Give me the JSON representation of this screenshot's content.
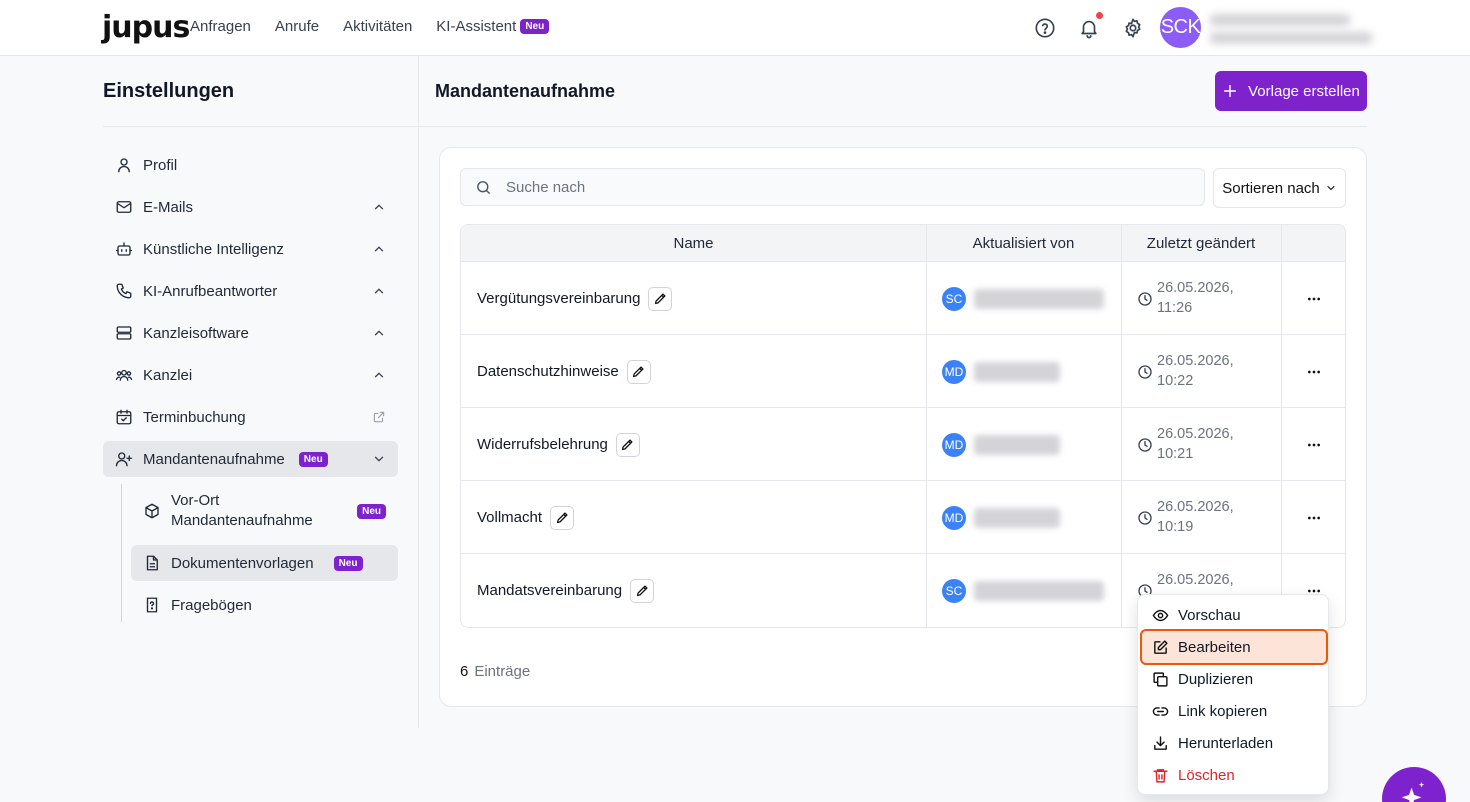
{
  "brand": "jupus",
  "nav": {
    "items": [
      "Anfragen",
      "Anrufe",
      "Aktivitäten",
      "KI-Assistent"
    ],
    "new_badge": "Neu"
  },
  "user": {
    "initials": "SCK"
  },
  "settings": {
    "title": "Einstellungen",
    "items": [
      {
        "label": "Profil",
        "icon": "user-icon"
      },
      {
        "label": "E-Mails",
        "icon": "mail-icon"
      },
      {
        "label": "Künstliche Intelligenz",
        "icon": "bot-icon"
      },
      {
        "label": "KI-Anrufbeantworter",
        "icon": "phone-icon"
      },
      {
        "label": "Kanzleisoftware",
        "icon": "server-icon"
      },
      {
        "label": "Kanzlei",
        "icon": "users-icon"
      },
      {
        "label": "Terminbuchung",
        "icon": "calendar-icon"
      },
      {
        "label": "Mandantenaufnahme",
        "icon": "user-plus-icon",
        "badge": "Neu"
      }
    ],
    "subitems": [
      {
        "label_line1": "Vor-Ort",
        "label_line2": "Mandantenaufnahme",
        "badge": "Neu"
      },
      {
        "label": "Dokumentenvorlagen",
        "badge": "Neu"
      },
      {
        "label": "Fragebögen"
      }
    ]
  },
  "main": {
    "title": "Mandantenaufnahme",
    "create_button": "Vorlage erstellen",
    "search_placeholder": "Suche nach",
    "sort_label": "Sortieren nach",
    "columns": [
      "Name",
      "Aktualisiert von",
      "Zuletzt geändert"
    ],
    "rows": [
      {
        "name": "Vergütungsvereinbarung",
        "initials": "SC",
        "date": "26.05.2026,",
        "time": "11:26"
      },
      {
        "name": "Datenschutzhinweise",
        "initials": "MD",
        "date": "26.05.2026,",
        "time": "10:22"
      },
      {
        "name": "Widerrufsbelehrung",
        "initials": "MD",
        "date": "26.05.2026,",
        "time": "10:21"
      },
      {
        "name": "Vollmacht",
        "initials": "MD",
        "date": "26.05.2026,",
        "time": "10:19"
      },
      {
        "name": "Mandatsvereinbarung",
        "initials": "SC",
        "date": "26.05.2026,",
        "time": ""
      }
    ],
    "count": "6",
    "count_label": "Einträge"
  },
  "menu": {
    "items": [
      "Vorschau",
      "Bearbeiten",
      "Duplizieren",
      "Link kopieren",
      "Herunterladen",
      "Löschen"
    ],
    "highlighted": "Bearbeiten",
    "danger_color": "#dc2626"
  },
  "colors": {
    "accent": "#7e22ce",
    "avatar": "#8b5cf6",
    "initials_bg": "#3b82f6"
  }
}
